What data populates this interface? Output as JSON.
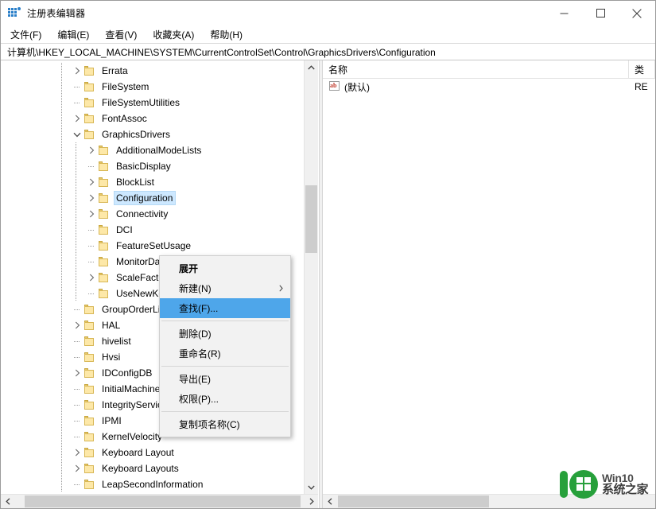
{
  "window": {
    "title": "注册表编辑器",
    "icon": "registry-editor-icon",
    "controls": {
      "minimize": "minimize-icon",
      "maximize": "maximize-icon",
      "close": "close-icon"
    }
  },
  "menubar": [
    {
      "label": "文件(F)"
    },
    {
      "label": "编辑(E)"
    },
    {
      "label": "查看(V)"
    },
    {
      "label": "收藏夹(A)"
    },
    {
      "label": "帮助(H)"
    }
  ],
  "address": {
    "path": "计算机\\HKEY_LOCAL_MACHINE\\SYSTEM\\CurrentControlSet\\Control\\GraphicsDrivers\\Configuration"
  },
  "tree": {
    "items": [
      {
        "label": "Errata",
        "indent": 0,
        "expander": "collapsed",
        "selected": false
      },
      {
        "label": "FileSystem",
        "indent": 0,
        "expander": "none",
        "selected": false
      },
      {
        "label": "FileSystemUtilities",
        "indent": 0,
        "expander": "none",
        "selected": false
      },
      {
        "label": "FontAssoc",
        "indent": 0,
        "expander": "collapsed",
        "selected": false
      },
      {
        "label": "GraphicsDrivers",
        "indent": 0,
        "expander": "expanded",
        "selected": false
      },
      {
        "label": "AdditionalModeLists",
        "indent": 1,
        "expander": "collapsed",
        "selected": false
      },
      {
        "label": "BasicDisplay",
        "indent": 1,
        "expander": "none",
        "selected": false
      },
      {
        "label": "BlockList",
        "indent": 1,
        "expander": "collapsed",
        "selected": false
      },
      {
        "label": "Configuration",
        "indent": 1,
        "expander": "collapsed",
        "selected": true
      },
      {
        "label": "Connectivity",
        "indent": 1,
        "expander": "collapsed",
        "selected": false
      },
      {
        "label": "DCI",
        "indent": 1,
        "expander": "none",
        "selected": false
      },
      {
        "label": "FeatureSetUsage",
        "indent": 1,
        "expander": "none",
        "selected": false
      },
      {
        "label": "MonitorDataStore",
        "indent": 1,
        "expander": "none",
        "selected": false
      },
      {
        "label": "ScaleFactors",
        "indent": 1,
        "expander": "collapsed",
        "selected": false
      },
      {
        "label": "UseNewKey",
        "indent": 1,
        "expander": "none",
        "selected": false
      },
      {
        "label": "GroupOrderList",
        "indent": 0,
        "expander": "none",
        "selected": false
      },
      {
        "label": "HAL",
        "indent": 0,
        "expander": "collapsed",
        "selected": false
      },
      {
        "label": "hivelist",
        "indent": 0,
        "expander": "none",
        "selected": false
      },
      {
        "label": "Hvsi",
        "indent": 0,
        "expander": "none",
        "selected": false
      },
      {
        "label": "IDConfigDB",
        "indent": 0,
        "expander": "collapsed",
        "selected": false
      },
      {
        "label": "InitialMachineConfig",
        "indent": 0,
        "expander": "none",
        "selected": false
      },
      {
        "label": "IntegrityServices",
        "indent": 0,
        "expander": "none",
        "selected": false
      },
      {
        "label": "IPMI",
        "indent": 0,
        "expander": "none",
        "selected": false
      },
      {
        "label": "KernelVelocity",
        "indent": 0,
        "expander": "none",
        "selected": false
      },
      {
        "label": "Keyboard Layout",
        "indent": 0,
        "expander": "collapsed",
        "selected": false
      },
      {
        "label": "Keyboard Layouts",
        "indent": 0,
        "expander": "collapsed",
        "selected": false
      },
      {
        "label": "LeapSecondInformation",
        "indent": 0,
        "expander": "none",
        "selected": false
      }
    ]
  },
  "list": {
    "columns": [
      {
        "label": "名称"
      },
      {
        "label": "类"
      }
    ],
    "rows": [
      {
        "name": "(默认)",
        "icon": "string-value-icon",
        "type": "RE"
      }
    ]
  },
  "context_menu": {
    "items": [
      {
        "label": "展开",
        "bold": true,
        "highlight": false,
        "submenu": false,
        "separator_after": false
      },
      {
        "label": "新建(N)",
        "bold": false,
        "highlight": false,
        "submenu": true,
        "separator_after": false
      },
      {
        "label": "查找(F)...",
        "bold": false,
        "highlight": true,
        "submenu": false,
        "separator_after": true
      },
      {
        "label": "删除(D)",
        "bold": false,
        "highlight": false,
        "submenu": false,
        "separator_after": false
      },
      {
        "label": "重命名(R)",
        "bold": false,
        "highlight": false,
        "submenu": false,
        "separator_after": true
      },
      {
        "label": "导出(E)",
        "bold": false,
        "highlight": false,
        "submenu": false,
        "separator_after": false
      },
      {
        "label": "权限(P)...",
        "bold": false,
        "highlight": false,
        "submenu": false,
        "separator_after": true
      },
      {
        "label": "复制项名称(C)",
        "bold": false,
        "highlight": false,
        "submenu": false,
        "separator_after": false
      }
    ]
  },
  "watermark": {
    "line1": "Win10",
    "line2": "系统之家"
  },
  "colors": {
    "selection": "#cde8ff",
    "menu_highlight": "#4ea6ea",
    "folder": "#fde8a8",
    "accent": "#2a7fc9",
    "watermark_green": "#27a03b"
  }
}
